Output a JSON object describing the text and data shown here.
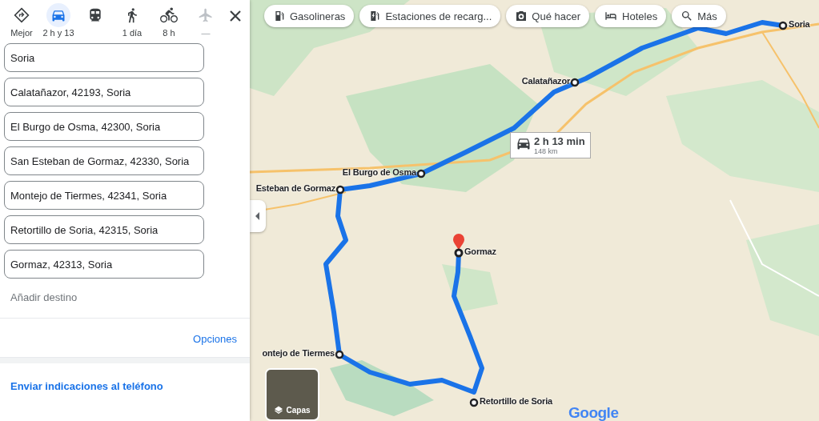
{
  "modes": [
    {
      "kind": "best",
      "label": "Mejor",
      "selected": false,
      "disabled": false
    },
    {
      "kind": "car",
      "label": "2 h y 13",
      "selected": true,
      "disabled": false
    },
    {
      "kind": "transit",
      "selected": false,
      "disabled": false
    },
    {
      "kind": "walk",
      "label": "1 día",
      "selected": false,
      "disabled": false
    },
    {
      "kind": "bike",
      "label": "8 h",
      "selected": false,
      "disabled": false
    },
    {
      "kind": "plane",
      "label": "—",
      "selected": false,
      "disabled": true
    }
  ],
  "stops": [
    {
      "value": "Soria"
    },
    {
      "value": "Calatañazor, 42193, Soria"
    },
    {
      "value": "El Burgo de Osma, 42300, Soria"
    },
    {
      "value": "San Esteban de Gormaz, 42330, Soria"
    },
    {
      "value": "Montejo de Tiermes, 42341, Soria"
    },
    {
      "value": "Retortillo de Soria, 42315, Soria"
    },
    {
      "value": "Gormaz, 42313, Soria"
    }
  ],
  "add_destination": "Añadir destino",
  "options": "Opciones",
  "send_to_phone": "Enviar indicaciones al teléfono",
  "chips": [
    {
      "kind": "gas",
      "label": "Gasolineras"
    },
    {
      "kind": "charge",
      "label": "Estaciones de recarg..."
    },
    {
      "kind": "camera",
      "label": "Qué hacer"
    },
    {
      "kind": "bed",
      "label": "Hoteles"
    },
    {
      "kind": "search",
      "label": "Más"
    }
  ],
  "map": {
    "waypoints": [
      {
        "label": "Soria",
        "final": false
      },
      {
        "label": "Calatañazor",
        "final": false
      },
      {
        "label": "El Burgo de Osma",
        "final": false
      },
      {
        "label": "Esteban de Gormaz",
        "final": false
      },
      {
        "label": "Gormaz",
        "final": true
      },
      {
        "label": "ontejo de Tiermes",
        "final": false
      },
      {
        "label": "Retortillo de Soria",
        "final": false
      }
    ],
    "route_time": "2 h 13 min",
    "route_distance": "148 km",
    "layers": "Capas",
    "logo": "Google"
  }
}
